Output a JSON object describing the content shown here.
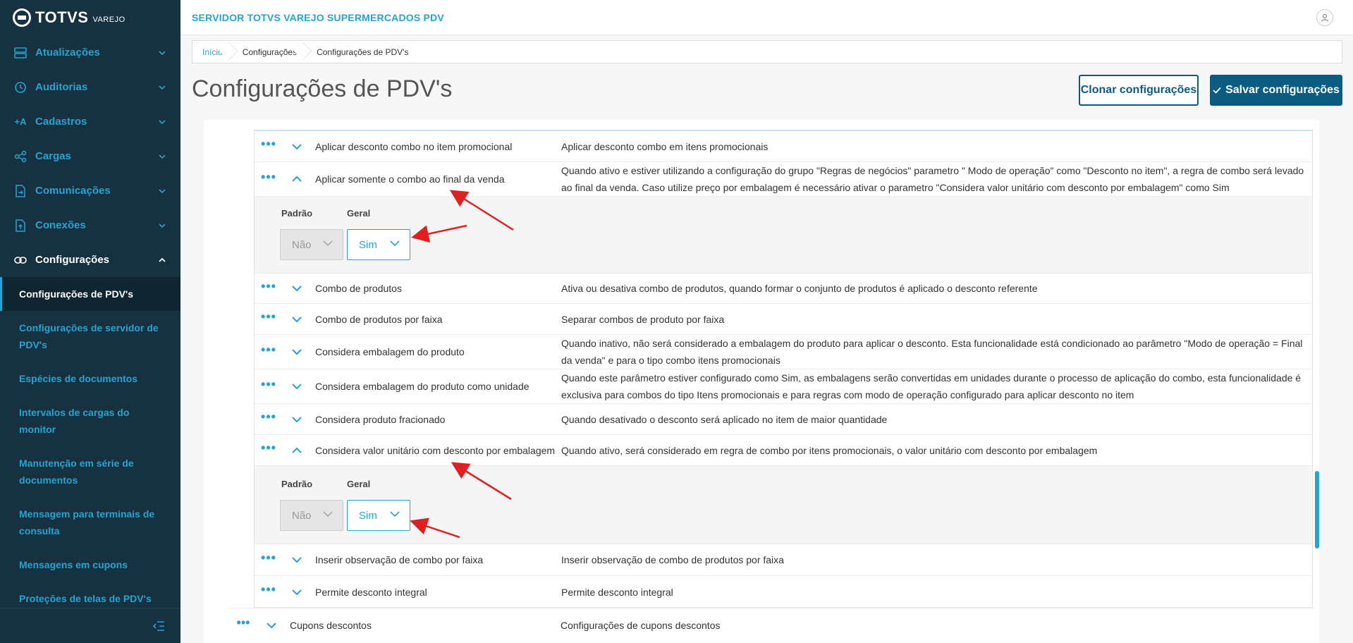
{
  "sidebar": {
    "brand": "TOTVS",
    "brand_sub": "VAREJO",
    "items": [
      {
        "label": "Atualizações"
      },
      {
        "label": "Auditorias"
      },
      {
        "label": "Cadastros"
      },
      {
        "label": "Cargas"
      },
      {
        "label": "Comunicações"
      },
      {
        "label": "Conexões"
      },
      {
        "label": "Configurações"
      }
    ],
    "subitems": [
      {
        "label": "Configurações de PDV's"
      },
      {
        "label": "Configurações de servidor de PDV's"
      },
      {
        "label": "Espécies de documentos"
      },
      {
        "label": "Intervalos de cargas do monitor"
      },
      {
        "label": "Manutenção em série de documentos"
      },
      {
        "label": "Mensagem para terminais de consulta"
      },
      {
        "label": "Mensagens em cupons"
      },
      {
        "label": "Proteções de telas de PDV's"
      }
    ]
  },
  "header": {
    "server_title": "SERVIDOR TOTVS VAREJO SUPERMERCADOS PDV"
  },
  "breadcrumb": [
    "Início",
    "Configurações",
    "Configurações de PDV's"
  ],
  "page": {
    "title": "Configurações de PDV's",
    "clone_label": "Clonar configurações",
    "save_label": "Salvar configurações"
  },
  "rows": [
    {
      "name": "Aplicar desconto combo no item promocional",
      "desc": "Aplicar desconto combo em itens promocionais"
    },
    {
      "name": "Aplicar somente o combo ao final da venda",
      "desc": "Quando ativo e estiver utilizando a configuração do grupo \"Regras de negócios\" parametro \" Modo de operação\" como \"Desconto no item\", a regra de combo será levado ao final da venda. Caso utilize preço por embalagem é necessário ativar o parametro \"Considera valor unitário com desconto por embalagem\" como Sim"
    },
    {
      "name": "Combo de produtos",
      "desc": "Ativa ou desativa combo de produtos, quando formar o conjunto de produtos é aplicado o desconto referente"
    },
    {
      "name": "Combo de produtos por faixa",
      "desc": "Separar combos de produto por faixa"
    },
    {
      "name": "Considera embalagem do produto",
      "desc": "Quando inativo, não será considerado a embalagem do produto para aplicar o desconto. Esta funcionalidade está condicionado ao parâmetro \"Modo de operação = Final da venda\" e para o tipo combo itens promocionais"
    },
    {
      "name": "Considera embalagem do produto como unidade",
      "desc": "Quando este parâmetro estiver configurado como Sim, as embalagens serão convertidas em unidades durante o processo de aplicação do combo, esta funcionalidade é exclusiva para combos do tipo Itens promocionais e para regras com modo de operação configurado para aplicar desconto no item"
    },
    {
      "name": "Considera produto fracionado",
      "desc": "Quando desativado o desconto será aplicado no item de maior quantidade"
    },
    {
      "name": "Considera valor unitário com desconto por embalagem",
      "desc": "Quando ativo, será considerado em regra de combo por itens promocionais, o valor unitário com desconto por embalagem"
    },
    {
      "name": "Inserir observação de combo por faixa",
      "desc": "Inserir observação de combo de produtos por faixa"
    },
    {
      "name": "Permite desconto integral",
      "desc": "Permite desconto integral"
    }
  ],
  "expanded": {
    "default_label": "Padrão",
    "general_label": "Geral",
    "default_value": "Não",
    "general_value": "Sim"
  },
  "group_row": {
    "name": "Cupons descontos",
    "desc": "Configurações de cupons descontos"
  },
  "dots": "•••",
  "colors": {
    "accent": "#27a3d1",
    "primary": "#0b5c80",
    "sidebar": "#163240",
    "annotation": "#e02020"
  }
}
